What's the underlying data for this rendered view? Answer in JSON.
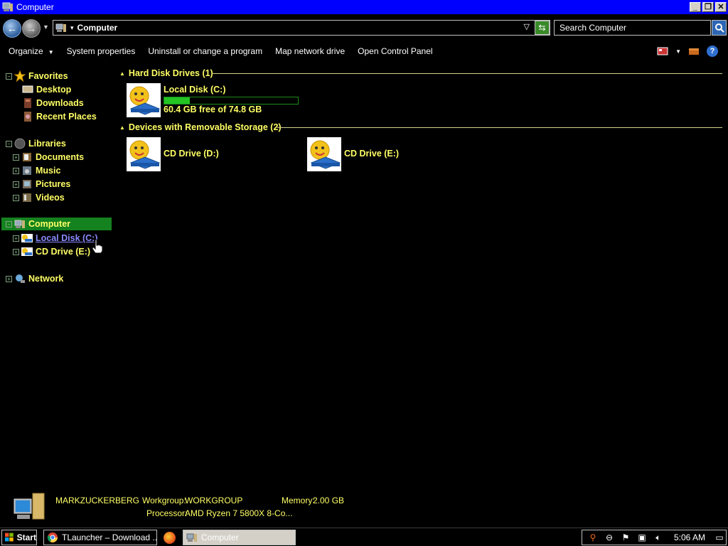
{
  "window": {
    "title": "Computer"
  },
  "address": {
    "crumb": "Computer",
    "search_placeholder": "Search Computer"
  },
  "toolbar": {
    "organize": "Organize",
    "system_properties": "System properties",
    "uninstall": "Uninstall or change a program",
    "map_drive": "Map network drive",
    "control_panel": "Open Control Panel"
  },
  "nav": {
    "favorites": "Favorites",
    "desktop": "Desktop",
    "downloads": "Downloads",
    "recent": "Recent Places",
    "libraries": "Libraries",
    "documents": "Documents",
    "music": "Music",
    "pictures": "Pictures",
    "videos": "Videos",
    "computer": "Computer",
    "local_disk": "Local Disk (C:)",
    "cd_drive_e": "CD Drive (E:)",
    "network": "Network"
  },
  "content": {
    "hdd_group": "Hard Disk Drives (1)",
    "removable_group": "Devices with Removable Storage (2)",
    "local_disk": {
      "name": "Local Disk (C:)",
      "free_text": "60.4 GB free of 74.8 GB",
      "used_fraction": 0.19
    },
    "cd_d": "CD Drive (D:)",
    "cd_e": "CD Drive (E:)"
  },
  "details": {
    "computer_name": "MARKZUCKERBERG",
    "workgroup_label": "Workgroup:",
    "workgroup": "WORKGROUP",
    "memory_label": "Memory:",
    "memory": "2.00 GB",
    "processor_label": "Processor:",
    "processor": "AMD Ryzen 7 5800X 8-Co..."
  },
  "taskbar": {
    "start": "Start",
    "task1": "TLauncher – Download ...",
    "task2": "Computer",
    "clock": "5:06 AM"
  },
  "colors": {
    "label": "#ffff66",
    "titlebar": "#0000ff",
    "selection": "#14821e",
    "progress": "#23c423"
  }
}
